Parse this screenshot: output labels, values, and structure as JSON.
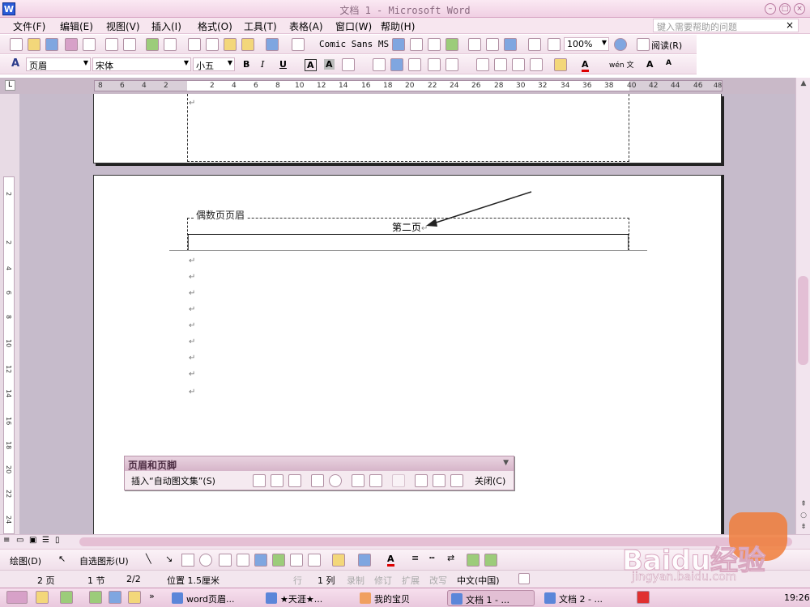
{
  "window": {
    "title": "文档 1 - Microsoft Word",
    "icon_label": "W"
  },
  "menu": {
    "items": [
      "文件(F)",
      "编辑(E)",
      "视图(V)",
      "插入(I)",
      "格式(O)",
      "工具(T)",
      "表格(A)",
      "窗口(W)",
      "帮助(H)"
    ],
    "help_placeholder": "键入需要帮助的问题"
  },
  "standard_toolbar": {
    "font_preview": "Comic Sans MS",
    "zoom": "100%",
    "read_button": "阅读(R)"
  },
  "format_toolbar": {
    "style": "页眉",
    "font": "宋体",
    "size": "小五",
    "bold": "B",
    "italic": "I",
    "underline": "U",
    "char_border": "A",
    "char_shade": "A",
    "enlarge": "A",
    "shrink": "A",
    "phonetic": "wén 文"
  },
  "ruler": {
    "numbers": [
      "8",
      "6",
      "4",
      "2",
      "2",
      "4",
      "6",
      "8",
      "10",
      "12",
      "14",
      "16",
      "18",
      "20",
      "22",
      "24",
      "26",
      "28",
      "30",
      "32",
      "34",
      "36",
      "38",
      "40",
      "42",
      "44",
      "46",
      "48"
    ],
    "corner": "L"
  },
  "vruler": {
    "numbers": [
      "2",
      "2",
      "4",
      "6",
      "8",
      "10",
      "12",
      "14",
      "16",
      "18",
      "20",
      "22",
      "24"
    ]
  },
  "document": {
    "header_label": "偶数页页眉",
    "header_text": "第二页",
    "para_mark": "↵"
  },
  "header_footer_toolbar": {
    "title": "页眉和页脚",
    "insert_autotext": "插入“自动图文集”(S)",
    "close": "关闭(C)"
  },
  "drawing_toolbar": {
    "draw": "绘图(D)",
    "autoshapes": "自选图形(U)"
  },
  "status": {
    "page": "2 页",
    "section": "1 节",
    "pages": "2/2",
    "position": "位置 1.5厘米",
    "line": "行",
    "column": "1 列",
    "rec": "录制",
    "trk": "修订",
    "ext": "扩展",
    "ovr": "改写",
    "language": "中文(中国)"
  },
  "taskbar": {
    "items": [
      "word页眉...",
      "★天涯★...",
      "我的宝贝",
      "文档 1 - ...",
      "文档 2 - ..."
    ],
    "active_index": 3,
    "clock": "19:26"
  },
  "watermark": {
    "text": "Baidu经验",
    "url": "jingyan.baidu.com"
  }
}
